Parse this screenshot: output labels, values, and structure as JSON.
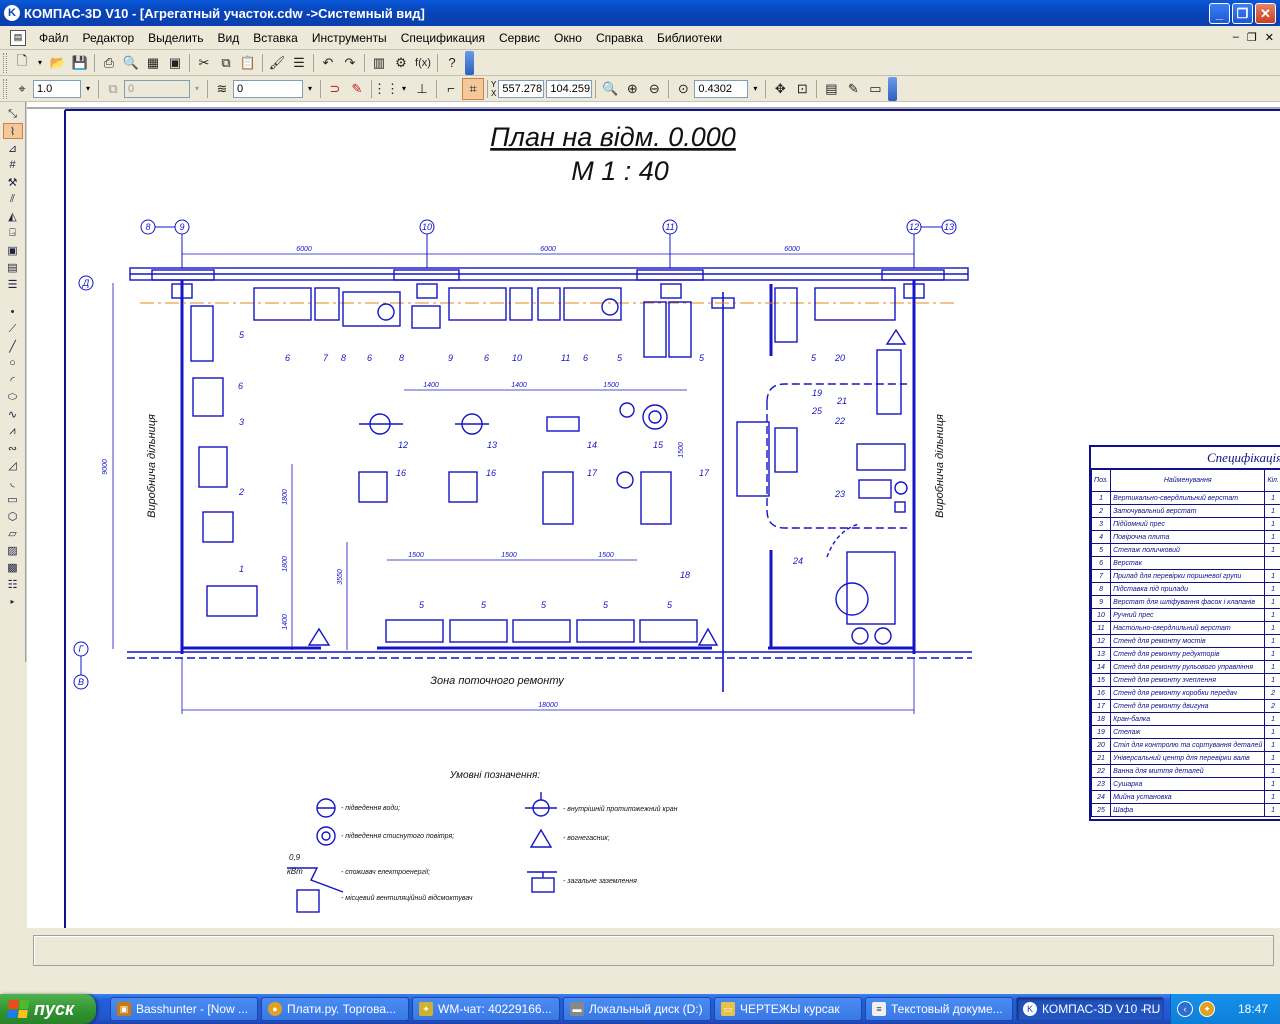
{
  "window": {
    "title": "КОМПАС-3D V10 - [Агрегатный участок.cdw ->Системный вид]",
    "app_icon": "kompas-logo-icon"
  },
  "menu": [
    "Файл",
    "Редактор",
    "Выделить",
    "Вид",
    "Вставка",
    "Инструменты",
    "Спецификация",
    "Сервис",
    "Окно",
    "Справка",
    "Библиотеки"
  ],
  "toolbar": {
    "line_scale": "1.0",
    "layer_disabled": "0",
    "style_value": "0",
    "coord_x_label": "X",
    "coord_y_label": "Y",
    "coord_x": "557.278",
    "coord_y": "104.259",
    "zoom": "0.4302"
  },
  "drawing": {
    "title": "План на відм. 0.000",
    "scale": "М 1 : 40",
    "axes_top": [
      "8",
      "9",
      "10",
      "11",
      "12",
      "13"
    ],
    "axes_left": [
      "Д",
      "Г",
      "В"
    ],
    "dims_top": [
      "6000",
      "6000",
      "6000"
    ],
    "dim_bottom": "18000",
    "dim_left": "9000",
    "dims_mid_top": [
      "1400",
      "1400",
      "1500"
    ],
    "dims_mid_bottom": [
      "1500",
      "1500",
      "1500"
    ],
    "dims_vertical": [
      "1500",
      "1800",
      "1400",
      "3550",
      "1800"
    ],
    "label_left_zone": "Виробнича дільниця",
    "label_right_zone": "Виробнича дільниця",
    "label_bottom_zone": "Зона поточного ремонту",
    "legend_title": "Умовні позначення:",
    "legend": [
      "- підведення води;",
      "- підведення стиснутого повітря;",
      "- споживач електроенергії;",
      "- місцевий вентиляційний відсмоктувач",
      "- внутрішній протипожежний кран",
      "- вогнегасник;",
      "- загальне заземлення"
    ],
    "power_note_1": "0,9",
    "power_note_2": "кВт"
  },
  "spec": {
    "title": "Специфікація",
    "headers": [
      "Поз.",
      "Найменування",
      "Кіл.",
      "Ра"
    ],
    "rows": [
      [
        "1",
        "Вертикально-свердлильний верстат",
        "1",
        ""
      ],
      [
        "2",
        "Заточувальний верстат",
        "1",
        ""
      ],
      [
        "3",
        "Підйомний прес",
        "1",
        ""
      ],
      [
        "4",
        "Повірочна плита",
        "1",
        ""
      ],
      [
        "5",
        "Стелаж поличковий",
        "1",
        ""
      ],
      [
        "6",
        "Верстак",
        "",
        ""
      ],
      [
        "7",
        "Прилад для перевірки поршневої групи",
        "1",
        ""
      ],
      [
        "8",
        "Підставка під прилади",
        "1",
        ""
      ],
      [
        "9",
        "Верстат для шліфування фасок і клапанів",
        "1",
        ""
      ],
      [
        "10",
        "Ручний прес",
        "1",
        ""
      ],
      [
        "11",
        "Настольно-свердлильний верстат",
        "1",
        ""
      ],
      [
        "12",
        "Стенд для ремонту мостів",
        "1",
        ""
      ],
      [
        "13",
        "Стенд для ремонту редукторів",
        "1",
        ""
      ],
      [
        "14",
        "Стенд для ремонту рульового управління",
        "1",
        ""
      ],
      [
        "15",
        "Стенд для ремонту зчеплення",
        "1",
        ""
      ],
      [
        "16",
        "Стенд для ремонту коробки передач",
        "2",
        ""
      ],
      [
        "17",
        "Стенд для ремонту двигуна",
        "2",
        ""
      ],
      [
        "18",
        "Кран-балка",
        "1",
        ""
      ],
      [
        "19",
        "Стелаж",
        "1",
        ""
      ],
      [
        "20",
        "Стіл для контролю та сортування деталей",
        "1",
        ""
      ],
      [
        "21",
        "Універсальний центр для перевірки валів",
        "1",
        ""
      ],
      [
        "22",
        "Ванна для миття деталей",
        "1",
        ""
      ],
      [
        "23",
        "Сушарка",
        "1",
        ""
      ],
      [
        "24",
        "Мийна установка",
        "1",
        ""
      ],
      [
        "25",
        "Шафа",
        "1",
        ""
      ]
    ]
  },
  "taskbar": {
    "start_label": "пуск",
    "tasks": [
      {
        "label": "Basshunter - [Now ...",
        "icon": "winamp-icon"
      },
      {
        "label": "Плати.ру. Торгова...",
        "icon": "chrome-icon"
      },
      {
        "label": "WM-чат: 40229166...",
        "icon": "webmoney-icon"
      },
      {
        "label": "Локальный диск (D:)",
        "icon": "drive-icon"
      },
      {
        "label": "ЧЕРТЕЖЫ курсак",
        "icon": "folder-icon"
      },
      {
        "label": "Текстовый докуме...",
        "icon": "notepad-icon"
      },
      {
        "label": "КОМПАС-3D V10 - ...",
        "icon": "kompas-icon"
      }
    ],
    "lang": "RU",
    "clock": "18:47"
  },
  "colors": {
    "drawing_blue": "#1414c8",
    "axis_orange": "#e08a1e",
    "titlebar_blue": "#0a58d8",
    "taskbar_blue": "#245edb"
  }
}
